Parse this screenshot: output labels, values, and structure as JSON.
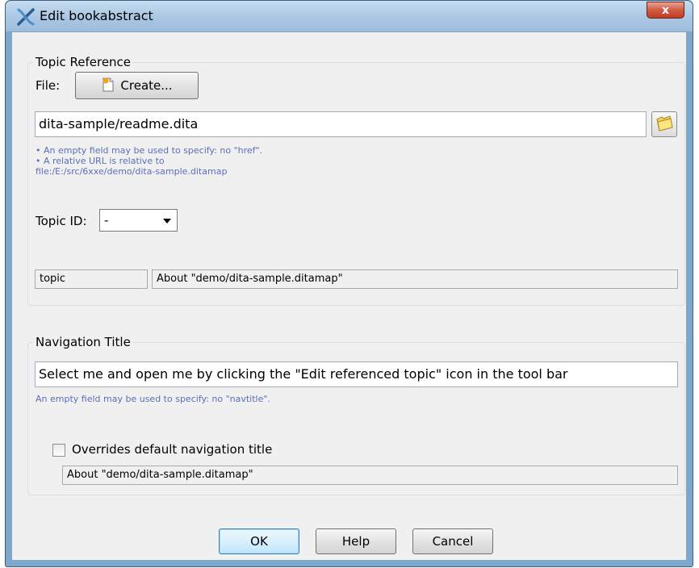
{
  "window": {
    "title": "Edit bookabstract",
    "close_glyph": "x"
  },
  "topic_reference": {
    "group_label": "Topic Reference",
    "file_label": "File:",
    "create_button": "Create...",
    "file_value": "dita-sample/readme.dita",
    "hint_line1": "• An empty field may be used to specify: no \"href\".",
    "hint_line2": "• A relative URL is relative to",
    "hint_line3": "file:/E:/src/6xxe/demo/dita-sample.ditamap",
    "topic_id_label": "Topic ID:",
    "topic_id_value": "-",
    "type_value": "topic",
    "topic_title_value": "About \"demo/dita-sample.ditamap\""
  },
  "navigation_title": {
    "group_label": "Navigation Title",
    "value": "Select me and open me by clicking the \"Edit referenced topic\" icon in the tool bar",
    "hint": "An empty field may be used to specify: no \"navtitle\".",
    "override_checkbox_label": "Overrides default navigation title",
    "override_checked": false,
    "default_title_value": "About \"demo/dita-sample.ditamap\""
  },
  "buttons": {
    "ok": "OK",
    "help": "Help",
    "cancel": "Cancel"
  },
  "icons": {
    "app": "dita-cross-icon",
    "create": "new-document-icon",
    "browse": "folder-icon"
  },
  "colors": {
    "hint_text": "#5b6fb7",
    "titlebar": "#a9c7e3",
    "close_button": "#c94a31"
  }
}
